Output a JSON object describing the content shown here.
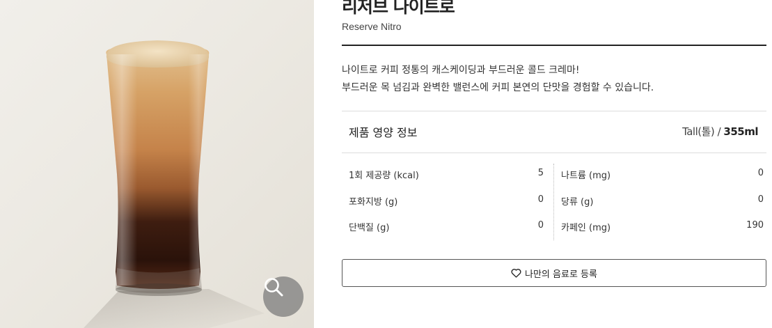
{
  "product": {
    "name_ko": "리저브 나이트로",
    "name_en": "Reserve Nitro",
    "description": [
      "나이트로 커피 정통의 캐스케이딩과 부드러운 콜드 크레마!",
      "부드러운 목 넘김과 완벽한 밸런스에 커피 본연의 단맛을 경험할 수 있습니다."
    ]
  },
  "nutrition": {
    "title": "제품 영양 정보",
    "size_label": "Tall(톨)",
    "separator": "/",
    "volume": "355ml",
    "left_column": [
      {
        "label": "1회 제공량 (kcal)",
        "value": "5"
      },
      {
        "label": "포화지방 (g)",
        "value": "0"
      },
      {
        "label": "단백질 (g)",
        "value": "0"
      }
    ],
    "right_column": [
      {
        "label": "나트륨 (mg)",
        "value": "0"
      },
      {
        "label": "당류 (g)",
        "value": "0"
      },
      {
        "label": "카페인 (mg)",
        "value": "190"
      }
    ]
  },
  "actions": {
    "favorite_label": "나만의 음료로 등록",
    "favorite_icon": "heart-outline-icon",
    "zoom_icon": "magnifier-icon"
  }
}
